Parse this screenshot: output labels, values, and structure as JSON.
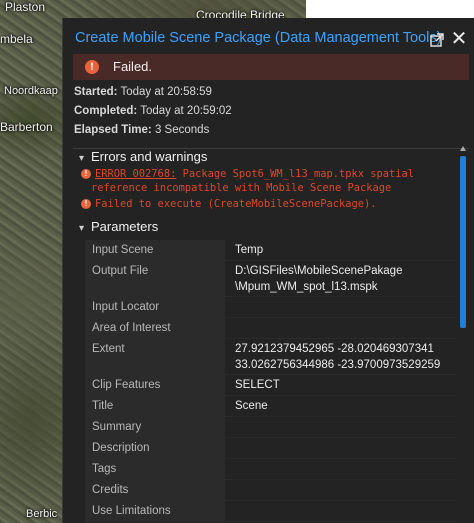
{
  "map": {
    "labels": [
      "Plaston",
      "Crocodile Bridge",
      "mbela",
      "Noordkaap",
      "Barberton",
      "Berbic"
    ]
  },
  "panel": {
    "title": "Create Mobile Scene Package (Data Management Tools)",
    "status": "Failed.",
    "started_label": "Started:",
    "started_value": "Today at 20:58:59",
    "completed_label": "Completed:",
    "completed_value": "Today at 20:59:02",
    "elapsed_label": "Elapsed Time:",
    "elapsed_value": "3 Seconds",
    "errors_heading": "Errors and warnings",
    "error_code": "ERROR 002768:",
    "error_msg_1": " Package Spot6_WM_l13_map.tpkx spatial",
    "error_msg_2": "reference incompatible with Mobile Scene Package",
    "error_msg_3": "Failed to execute (CreateMobileScenePackage).",
    "params_heading": "Parameters",
    "params": [
      {
        "key": "Input Scene",
        "value": "Temp",
        "value2": ""
      },
      {
        "key": "Output File",
        "value": "D:\\GISFiles\\MobileScenePakage",
        "value2": "\\Mpum_WM_spot_l13.mspk"
      },
      {
        "key": "Input Locator",
        "value": "",
        "value2": ""
      },
      {
        "key": "Area of Interest",
        "value": "",
        "value2": ""
      },
      {
        "key": "Extent",
        "value": "27.9212379452965 -28.020469307341",
        "value2": "33.0262756344986 -23.9700973529259"
      },
      {
        "key": "Clip Features",
        "value": "SELECT",
        "value2": ""
      },
      {
        "key": "Title",
        "value": "Scene",
        "value2": ""
      },
      {
        "key": "Summary",
        "value": "",
        "value2": ""
      },
      {
        "key": "Description",
        "value": "",
        "value2": ""
      },
      {
        "key": "Tags",
        "value": "",
        "value2": ""
      },
      {
        "key": "Credits",
        "value": "",
        "value2": ""
      },
      {
        "key": "Use Limitations",
        "value": "",
        "value2": ""
      }
    ]
  },
  "colors": {
    "accent": "#3aa3ff",
    "error": "#e0462a",
    "fail_bg": "#4a2a26",
    "scroll_thumb": "#1f7fd6"
  },
  "icons": {
    "status": "error-circle-icon",
    "popout": "popout-icon",
    "close": "close-icon",
    "chevron": "chevron-down-icon"
  }
}
